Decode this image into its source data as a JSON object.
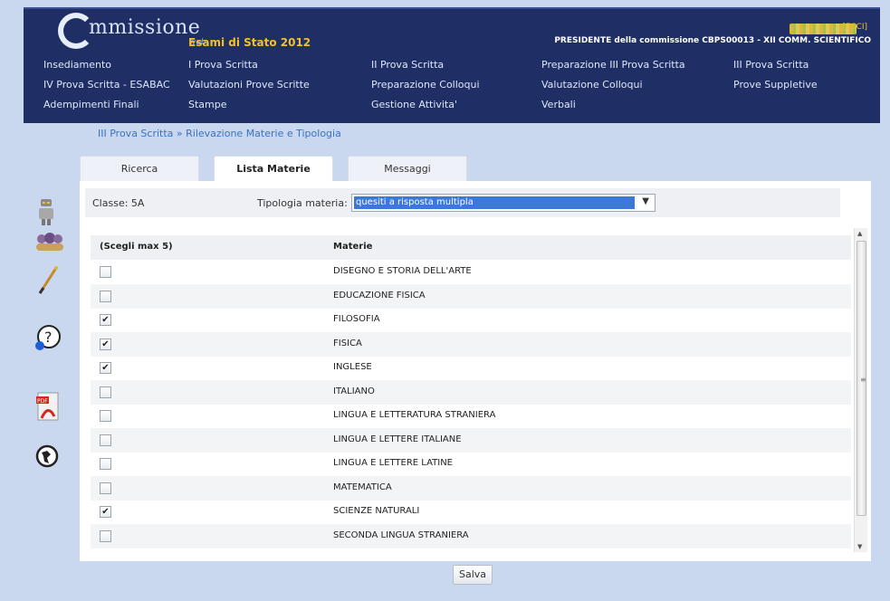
{
  "header": {
    "logo_word": "mmissione",
    "logo_web": "web",
    "subtitle": "Esami di Stato 2012",
    "esci": "[ESCI]",
    "commission_line": "PRESIDENTE della commissione CBPS00013 - XII COMM. SCIENTIFICO"
  },
  "menu": [
    {
      "label": "Insediamento"
    },
    {
      "label": "I Prova Scritta"
    },
    {
      "label": "II Prova Scritta"
    },
    {
      "label": "Preparazione III Prova Scritta"
    },
    {
      "label": "III Prova Scritta"
    },
    {
      "label": "IV Prova Scritta - ESABAC"
    },
    {
      "label": "Valutazioni Prove Scritte"
    },
    {
      "label": "Preparazione Colloqui"
    },
    {
      "label": "Valutazione Colloqui"
    },
    {
      "label": "Prove Suppletive"
    },
    {
      "label": "Adempimenti Finali"
    },
    {
      "label": "Stampe"
    },
    {
      "label": "Gestione Attivita'"
    },
    {
      "label": "Verbali"
    }
  ],
  "breadcrumb": "III Prova Scritta » Rilevazione Materie e Tipologia",
  "tabs": [
    {
      "label": "Ricerca"
    },
    {
      "label": "Lista Materie"
    },
    {
      "label": "Messaggi"
    }
  ],
  "filter": {
    "classe_label": "Classe: 5A",
    "tipologia_label": "Tipologia materia:",
    "tipologia_value": "quesiti a risposta multipla"
  },
  "table": {
    "col_choose": "(Scegli max 5)",
    "col_materie": "Materie",
    "rows": [
      {
        "name": "DISEGNO E STORIA DELL'ARTE",
        "checked": false
      },
      {
        "name": "EDUCAZIONE FISICA",
        "checked": false
      },
      {
        "name": "FILOSOFIA",
        "checked": true
      },
      {
        "name": "FISICA",
        "checked": true
      },
      {
        "name": "INGLESE",
        "checked": true
      },
      {
        "name": "ITALIANO",
        "checked": false
      },
      {
        "name": "LINGUA E LETTERATURA STRANIERA",
        "checked": false
      },
      {
        "name": "LINGUA E LETTERE ITALIANE",
        "checked": false
      },
      {
        "name": "LINGUA E LETTERE LATINE",
        "checked": false
      },
      {
        "name": "MATEMATICA",
        "checked": false
      },
      {
        "name": "SCIENZE NATURALI",
        "checked": true
      },
      {
        "name": "SECONDA LINGUA STRANIERA",
        "checked": false
      }
    ]
  },
  "save_label": "Salva",
  "side_icons": [
    "robot-icon",
    "group-icon",
    "pen-icon",
    "help-icon",
    "pdf-icon",
    "globe-icon"
  ]
}
